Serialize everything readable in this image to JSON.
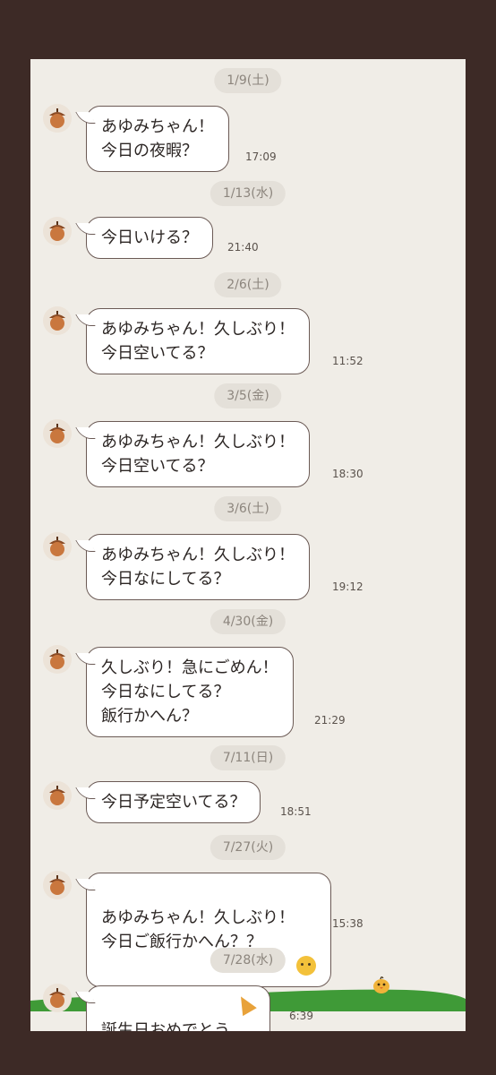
{
  "chat": {
    "messages": [
      {
        "date": "1/9(土)",
        "text": "あゆみちゃん！\n今日の夜暇？",
        "time": "17:09"
      },
      {
        "date": "1/13(水)",
        "text": "今日いける？",
        "time": "21:40"
      },
      {
        "date": "2/6(土)",
        "text": "あゆみちゃん！久しぶり！\n今日空いてる？",
        "time": "11:52"
      },
      {
        "date": "3/5(金)",
        "text": "あゆみちゃん！久しぶり！\n今日空いてる？",
        "time": "18:30"
      },
      {
        "date": "3/6(土)",
        "text": "あゆみちゃん！久しぶり！\n今日なにしてる？",
        "time": "19:12"
      },
      {
        "date": "4/30(金)",
        "text": "久しぶり！急にごめん！\n今日なにしてる？\n飯行かへん？",
        "time": "21:29"
      },
      {
        "date": "7/11(日)",
        "text": "今日予定空いてる？",
        "time": "18:51"
      },
      {
        "date": "7/27(火)",
        "text": "あゆみちゃん！久しぶり！\n今日ご飯行かへん？？",
        "time": "15:38",
        "emoji": "thinking-face-icon"
      },
      {
        "date": "7/28(水)",
        "text": "誕生日おめでとう",
        "time": "6:39",
        "emoji": "party-popper-icon"
      }
    ]
  },
  "colors": {
    "outer_background": "#3d2a26",
    "chat_background": "#f0ede7",
    "bubble_border": "#6b5a55",
    "date_pill": "#e4e0d9",
    "acorn": "#c9773e",
    "grass": "#3f9a37"
  },
  "icons": {
    "avatar": "acorn-icon",
    "decoration": "chick-on-hill-icon"
  }
}
